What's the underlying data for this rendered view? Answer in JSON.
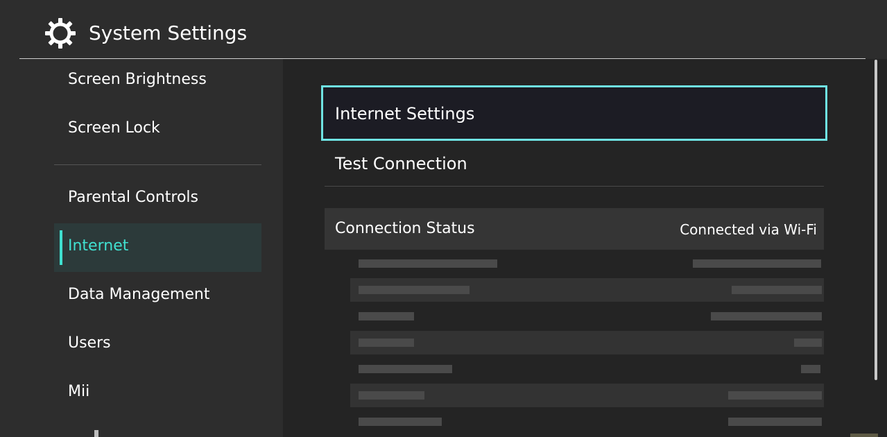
{
  "header": {
    "title": "System Settings",
    "icon": "gear-icon"
  },
  "sidebar": {
    "items": [
      {
        "label": "Screen Brightness"
      },
      {
        "label": "Screen Lock"
      },
      {
        "label": "Parental Controls"
      },
      {
        "label": "Internet",
        "active": true
      },
      {
        "label": "Data Management"
      },
      {
        "label": "Users"
      },
      {
        "label": "Mii"
      }
    ]
  },
  "content": {
    "internet_settings_label": "Internet Settings",
    "test_connection_label": "Test Connection",
    "connection_status": {
      "label": "Connection Status",
      "value": "Connected via Wi-Fi"
    }
  },
  "colors": {
    "accent": "#40e0d0",
    "selection_border": "#6fe3e3",
    "background": "#2d2d2d",
    "content_background": "#242424"
  }
}
